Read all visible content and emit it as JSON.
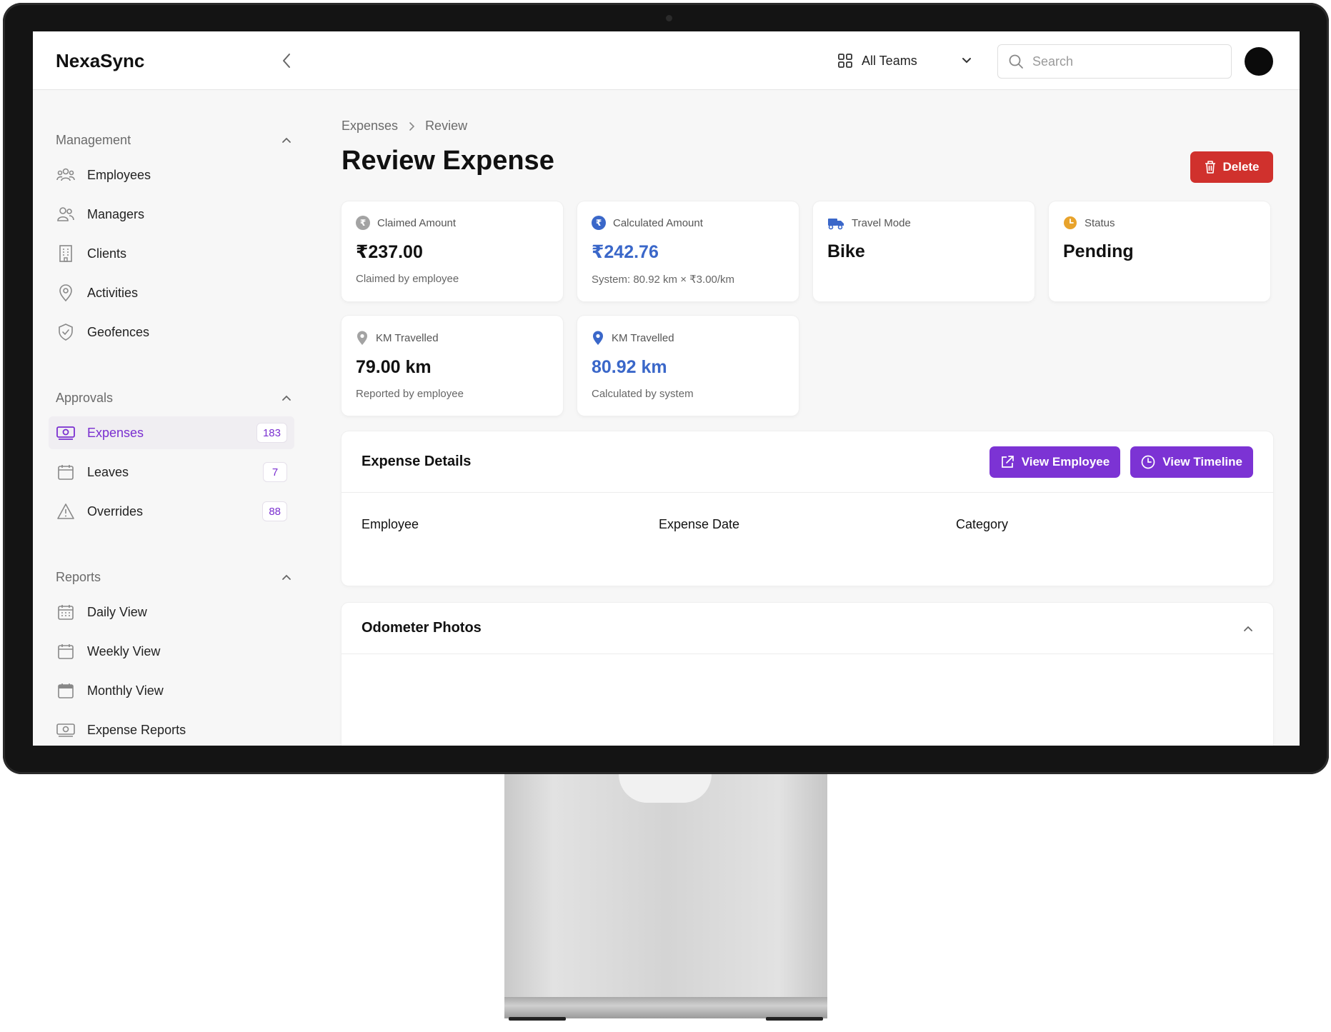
{
  "app": {
    "brand": "NexaSync"
  },
  "header": {
    "teams_label": "All Teams",
    "search_placeholder": "Search"
  },
  "sidebar": {
    "sections": [
      {
        "title": "Management",
        "items": [
          {
            "label": "Employees",
            "icon": "users-icon"
          },
          {
            "label": "Managers",
            "icon": "user-group-icon"
          },
          {
            "label": "Clients",
            "icon": "building-icon"
          },
          {
            "label": "Activities",
            "icon": "map-pin-icon"
          },
          {
            "label": "Geofences",
            "icon": "shield-check-icon"
          }
        ]
      },
      {
        "title": "Approvals",
        "items": [
          {
            "label": "Expenses",
            "icon": "banknote-icon",
            "badge": "183",
            "active": true
          },
          {
            "label": "Leaves",
            "icon": "calendar-icon",
            "badge": "7"
          },
          {
            "label": "Overrides",
            "icon": "warning-icon",
            "badge": "88"
          }
        ]
      },
      {
        "title": "Reports",
        "items": [
          {
            "label": "Daily View",
            "icon": "calendar-days-icon"
          },
          {
            "label": "Weekly View",
            "icon": "calendar-week-icon"
          },
          {
            "label": "Monthly View",
            "icon": "calendar-month-icon"
          },
          {
            "label": "Expense Reports",
            "icon": "banknote-icon"
          }
        ]
      }
    ]
  },
  "breadcrumb": [
    "Expenses",
    "Review"
  ],
  "page": {
    "title": "Review Expense",
    "delete_label": "Delete"
  },
  "cards": [
    {
      "label": "Claimed Amount",
      "value": "₹237.00",
      "sub": "Claimed by employee",
      "icon": "rupee-icon",
      "icon_color": "#9a9a9a"
    },
    {
      "label": "Calculated Amount",
      "value": "₹242.76",
      "sub": "System: 80.92 km × ₹3.00/km",
      "icon": "rupee-icon",
      "icon_color": "#3a67c9"
    },
    {
      "label": "Travel Mode",
      "value": "Bike",
      "sub": "",
      "icon": "truck-icon",
      "icon_color": "#3a67c9"
    },
    {
      "label": "Status",
      "value": "Pending",
      "sub": "",
      "icon": "clock-icon",
      "icon_color": "#e8a32c"
    },
    {
      "label": "KM Travelled",
      "value": "79.00 km",
      "sub": "Reported by employee",
      "icon": "map-pin-icon",
      "icon_color": "#9a9a9a"
    },
    {
      "label": "KM Travelled",
      "value": "80.92 km",
      "sub": "Calculated by system",
      "icon": "map-pin-icon",
      "icon_color": "#3a67c9"
    }
  ],
  "expense_details": {
    "title": "Expense Details",
    "view_employee_label": "View Employee",
    "view_timeline_label": "View Timeline",
    "columns": [
      "Employee",
      "Expense Date",
      "Category"
    ]
  },
  "odometer": {
    "title": "Odometer Photos"
  },
  "colors": {
    "accent": "#7c33d4",
    "danger": "#d0312d",
    "info": "#3a67c9"
  }
}
